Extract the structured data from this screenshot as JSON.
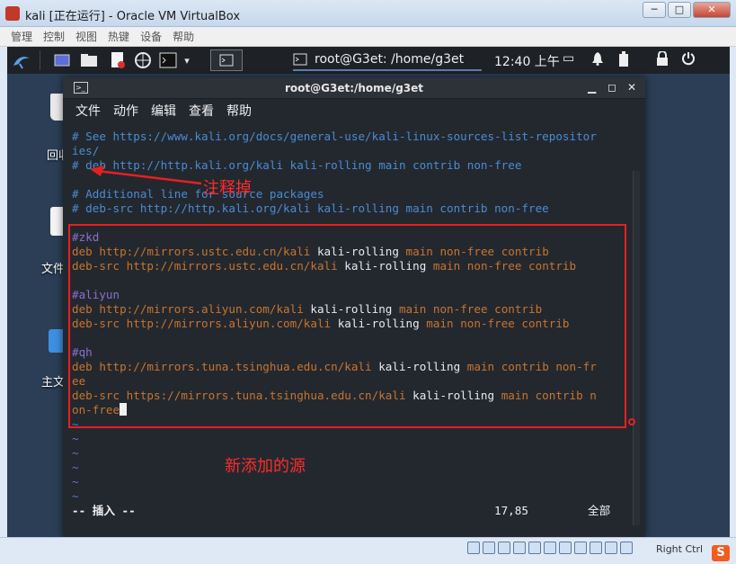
{
  "window": {
    "title": "kali [正在运行] - Oracle VM VirtualBox",
    "controls": [
      "─",
      "□",
      "✕"
    ]
  },
  "vb_menu": [
    "管理",
    "控制",
    "视图",
    "热键",
    "设备",
    "帮助"
  ],
  "kali_panel": {
    "task_label": "root@G3et: /home/g3et",
    "clock": "12:40 上午"
  },
  "desktop_icons": [
    {
      "label": "回收"
    },
    {
      "label": "文件"
    },
    {
      "label": "主文"
    }
  ],
  "terminal": {
    "title": "root@G3et:/home/g3et",
    "menu": [
      "文件",
      "动作",
      "编辑",
      "查看",
      "帮助"
    ],
    "lines": {
      "l1": "# See https://www.kali.org/docs/general-use/kali-linux-sources-list-repositor",
      "l2": "ies/",
      "l3": "# deb http://http.kali.org/kali kali-rolling main contrib non-free",
      "l4": "# Additional line for source packages",
      "l5": "# deb-src http://http.kali.org/kali kali-rolling main contrib non-free",
      "zkd": "#zkd",
      "zkd_deb_kw": "deb http://mirrors.ustc.edu.cn/kali ",
      "zkd_deb_tx": "kali-rolling",
      "zkd_deb_rest": " main non-free contrib",
      "zkd_src_kw": "deb-src http://mirrors.ustc.edu.cn/kali ",
      "zkd_src_tx": "kali-rolling",
      "zkd_src_rest": " main non-free contrib",
      "aliyun": "#aliyun",
      "ali_deb_kw": "deb http://mirrors.aliyun.com/kali ",
      "ali_deb_tx": "kali-rolling",
      "ali_deb_rest": " main non-free contrib",
      "ali_src_kw": "deb-src http://mirrors.aliyun.com/kali ",
      "ali_src_tx": "kali-rolling",
      "ali_src_rest": " main non-free contrib",
      "qh": "#qh",
      "qh_deb_kw": "deb http://mirrors.tuna.tsinghua.edu.cn/kali ",
      "qh_deb_tx": "kali-rolling",
      "qh_deb_rest": " main contrib non-fr",
      "qh_deb_wrap": "ee",
      "qh_src_kw": "deb-src https://mirrors.tuna.tsinghua.edu.cn/kali ",
      "qh_src_tx": "kali-rolling",
      "qh_src_rest": " main contrib n",
      "qh_src_wrap": "on-free",
      "tilde": "~"
    },
    "status_mode": "-- 插入 --",
    "status_pos": "17,85",
    "status_all": "全部"
  },
  "annotations": {
    "comment_out": "注释掉",
    "new_sources": "新添加的源"
  },
  "statusbar": {
    "hostkey": "Right Ctrl"
  },
  "ime_logo": "S",
  "colors": {
    "annotation_red": "#e62020",
    "comment_blue": "#4a8bd1",
    "keyword_orange": "#c8742c",
    "terminal_bg": "#23282f"
  }
}
